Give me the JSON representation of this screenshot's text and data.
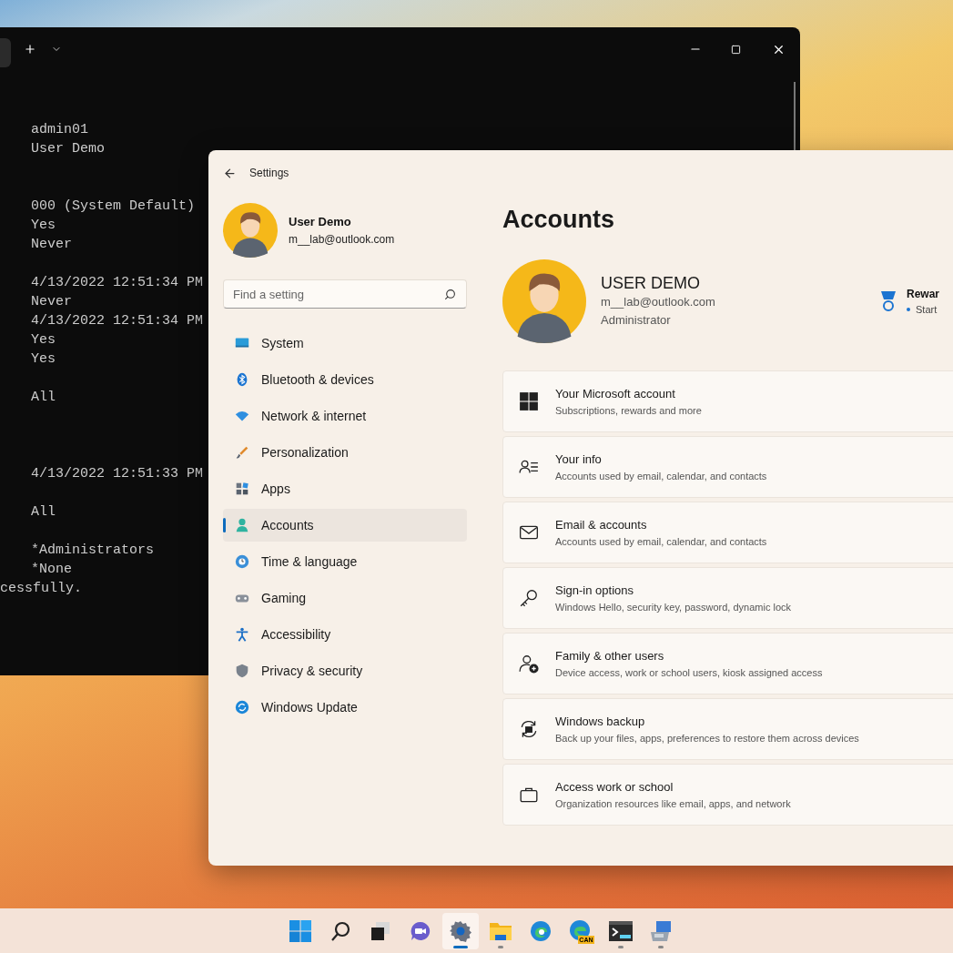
{
  "terminal": {
    "blocks": [
      {
        "kind": "tight",
        "indent": true,
        "lines": [
          "admin01",
          "User Demo"
        ]
      },
      {
        "kind": "wide",
        "indent": true,
        "lines": [
          "000 (System Default)",
          "Yes",
          "Never"
        ]
      },
      {
        "kind": "spaced",
        "indent": true,
        "lines": [
          "4/13/2022 12:51:34 PM",
          "Never",
          "4/13/2022 12:51:34 PM",
          "Yes",
          "Yes"
        ]
      },
      {
        "kind": "spaced",
        "indent": true,
        "lines": [
          "All"
        ]
      },
      {
        "kind": "wider",
        "indent": true,
        "lines": [
          "4/13/2022 12:51:33 PM"
        ]
      },
      {
        "kind": "spaced",
        "indent": true,
        "lines": [
          "All"
        ]
      },
      {
        "kind": "spaced",
        "indent": true,
        "lines": [
          "*Administrators",
          "*None"
        ]
      },
      {
        "kind": "tight",
        "indent": false,
        "lines": [
          "cessfully."
        ]
      }
    ]
  },
  "settings": {
    "title": "Settings",
    "profile": {
      "name": "User Demo",
      "email": "m__lab@outlook.com"
    },
    "search": {
      "placeholder": "Find a setting"
    },
    "nav": [
      {
        "label": "System",
        "selected": false
      },
      {
        "label": "Bluetooth & devices",
        "selected": false
      },
      {
        "label": "Network & internet",
        "selected": false
      },
      {
        "label": "Personalization",
        "selected": false
      },
      {
        "label": "Apps",
        "selected": false
      },
      {
        "label": "Accounts",
        "selected": true
      },
      {
        "label": "Time & language",
        "selected": false
      },
      {
        "label": "Gaming",
        "selected": false
      },
      {
        "label": "Accessibility",
        "selected": false
      },
      {
        "label": "Privacy & security",
        "selected": false
      },
      {
        "label": "Windows Update",
        "selected": false
      }
    ],
    "page_title": "Accounts",
    "account": {
      "name": "USER DEMO",
      "email": "m__lab@outlook.com",
      "role": "Administrator"
    },
    "rewards": {
      "title": "Rewar",
      "item": "Start"
    },
    "cards": [
      {
        "title": "Your Microsoft account",
        "subtitle": "Subscriptions, rewards and more"
      },
      {
        "title": "Your info",
        "subtitle": "Accounts used by email, calendar, and contacts"
      },
      {
        "title": "Email & accounts",
        "subtitle": "Accounts used by email, calendar, and contacts"
      },
      {
        "title": "Sign-in options",
        "subtitle": "Windows Hello, security key, password, dynamic lock"
      },
      {
        "title": "Family & other users",
        "subtitle": "Device access, work or school users, kiosk assigned access"
      },
      {
        "title": "Windows backup",
        "subtitle": "Back up your files, apps, preferences to restore them across devices"
      },
      {
        "title": "Access work or school",
        "subtitle": "Organization resources like email, apps, and network"
      }
    ]
  },
  "taskbar": {
    "items": [
      {
        "kind": "start",
        "selected": false,
        "running": false
      },
      {
        "kind": "search",
        "selected": false,
        "running": false
      },
      {
        "kind": "task-view",
        "selected": false,
        "running": false
      },
      {
        "kind": "chat",
        "selected": false,
        "running": false
      },
      {
        "kind": "settings",
        "selected": true,
        "running": true
      },
      {
        "kind": "explorer",
        "selected": false,
        "running": true
      },
      {
        "kind": "edge",
        "selected": false,
        "running": false
      },
      {
        "kind": "edge-canary",
        "selected": false,
        "running": false,
        "badge": "CAN"
      },
      {
        "kind": "terminal",
        "selected": false,
        "running": true
      },
      {
        "kind": "control-panel",
        "selected": false,
        "running": true
      }
    ]
  }
}
